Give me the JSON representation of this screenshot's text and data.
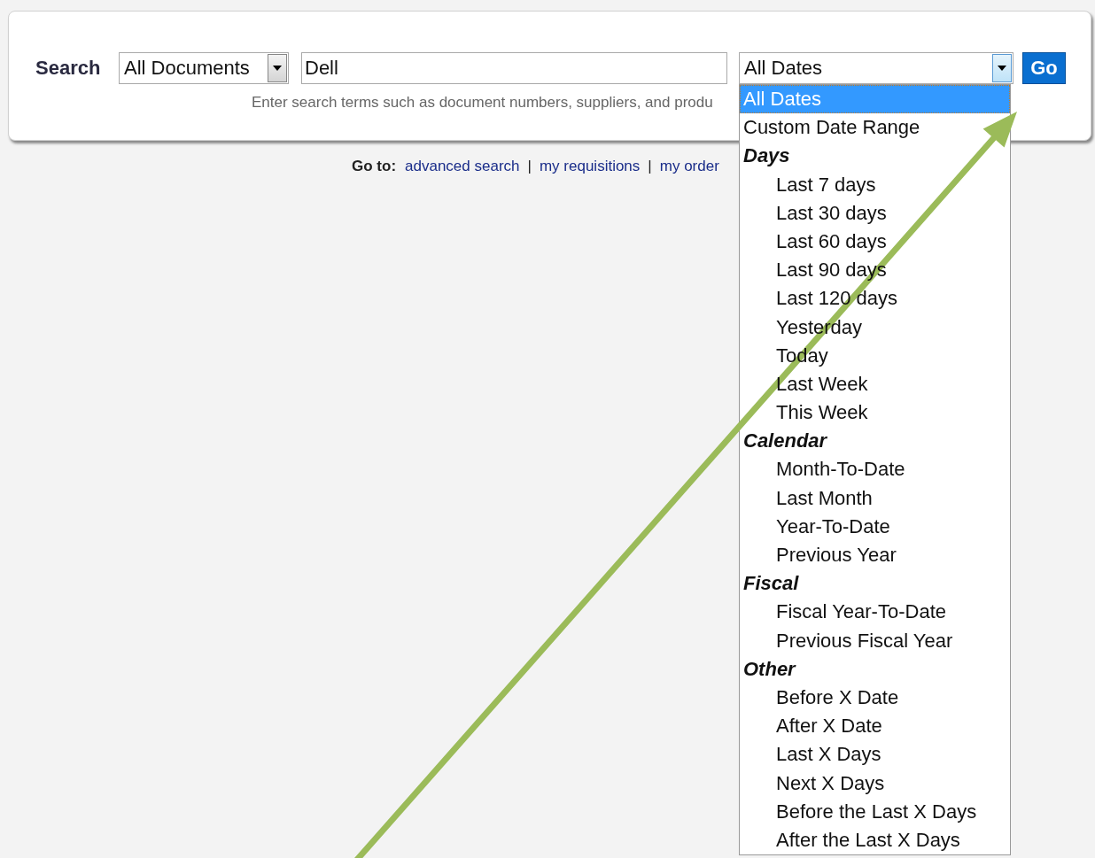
{
  "search": {
    "label": "Search",
    "scope": {
      "value": "All Documents"
    },
    "query": {
      "value": "Dell"
    },
    "date": {
      "value": "All Dates"
    },
    "go": "Go",
    "hint": "Enter search terms such as document numbers, suppliers, and produ"
  },
  "goto": {
    "label": "Go to:",
    "items": [
      {
        "kind": "link",
        "text": "advanced search"
      },
      {
        "kind": "separator",
        "text": "|"
      },
      {
        "kind": "link",
        "text": "my requisitions"
      },
      {
        "kind": "separator",
        "text": "|"
      },
      {
        "kind": "link",
        "text": "my order"
      }
    ]
  },
  "date_menu": [
    {
      "kind": "option",
      "label": "All Dates",
      "selected": true
    },
    {
      "kind": "option",
      "label": "Custom Date Range",
      "selected": false
    },
    {
      "kind": "group",
      "label": "Days",
      "children": [
        {
          "label": "Last 7 days",
          "selected": false
        },
        {
          "label": "Last 30 days",
          "selected": false
        },
        {
          "label": "Last 60 days",
          "selected": false
        },
        {
          "label": "Last 90 days",
          "selected": false
        },
        {
          "label": "Last 120 days",
          "selected": false
        },
        {
          "label": "Yesterday",
          "selected": false
        },
        {
          "label": "Today",
          "selected": false
        },
        {
          "label": "Last Week",
          "selected": false
        },
        {
          "label": "This Week",
          "selected": false
        }
      ]
    },
    {
      "kind": "group",
      "label": "Calendar",
      "children": [
        {
          "label": "Month-To-Date",
          "selected": false
        },
        {
          "label": "Last Month",
          "selected": false
        },
        {
          "label": "Year-To-Date",
          "selected": false
        },
        {
          "label": "Previous Year",
          "selected": false
        }
      ]
    },
    {
      "kind": "group",
      "label": "Fiscal",
      "children": [
        {
          "label": "Fiscal Year-To-Date",
          "selected": false
        },
        {
          "label": "Previous Fiscal Year",
          "selected": false
        }
      ]
    },
    {
      "kind": "group",
      "label": "Other",
      "children": [
        {
          "label": "Before X Date",
          "selected": false
        },
        {
          "label": "After X Date",
          "selected": false
        },
        {
          "label": "Last X Days",
          "selected": false
        },
        {
          "label": "Next X Days",
          "selected": false
        },
        {
          "label": "Before the Last X Days",
          "selected": false
        },
        {
          "label": "After the Last X Days",
          "selected": false
        }
      ]
    }
  ]
}
